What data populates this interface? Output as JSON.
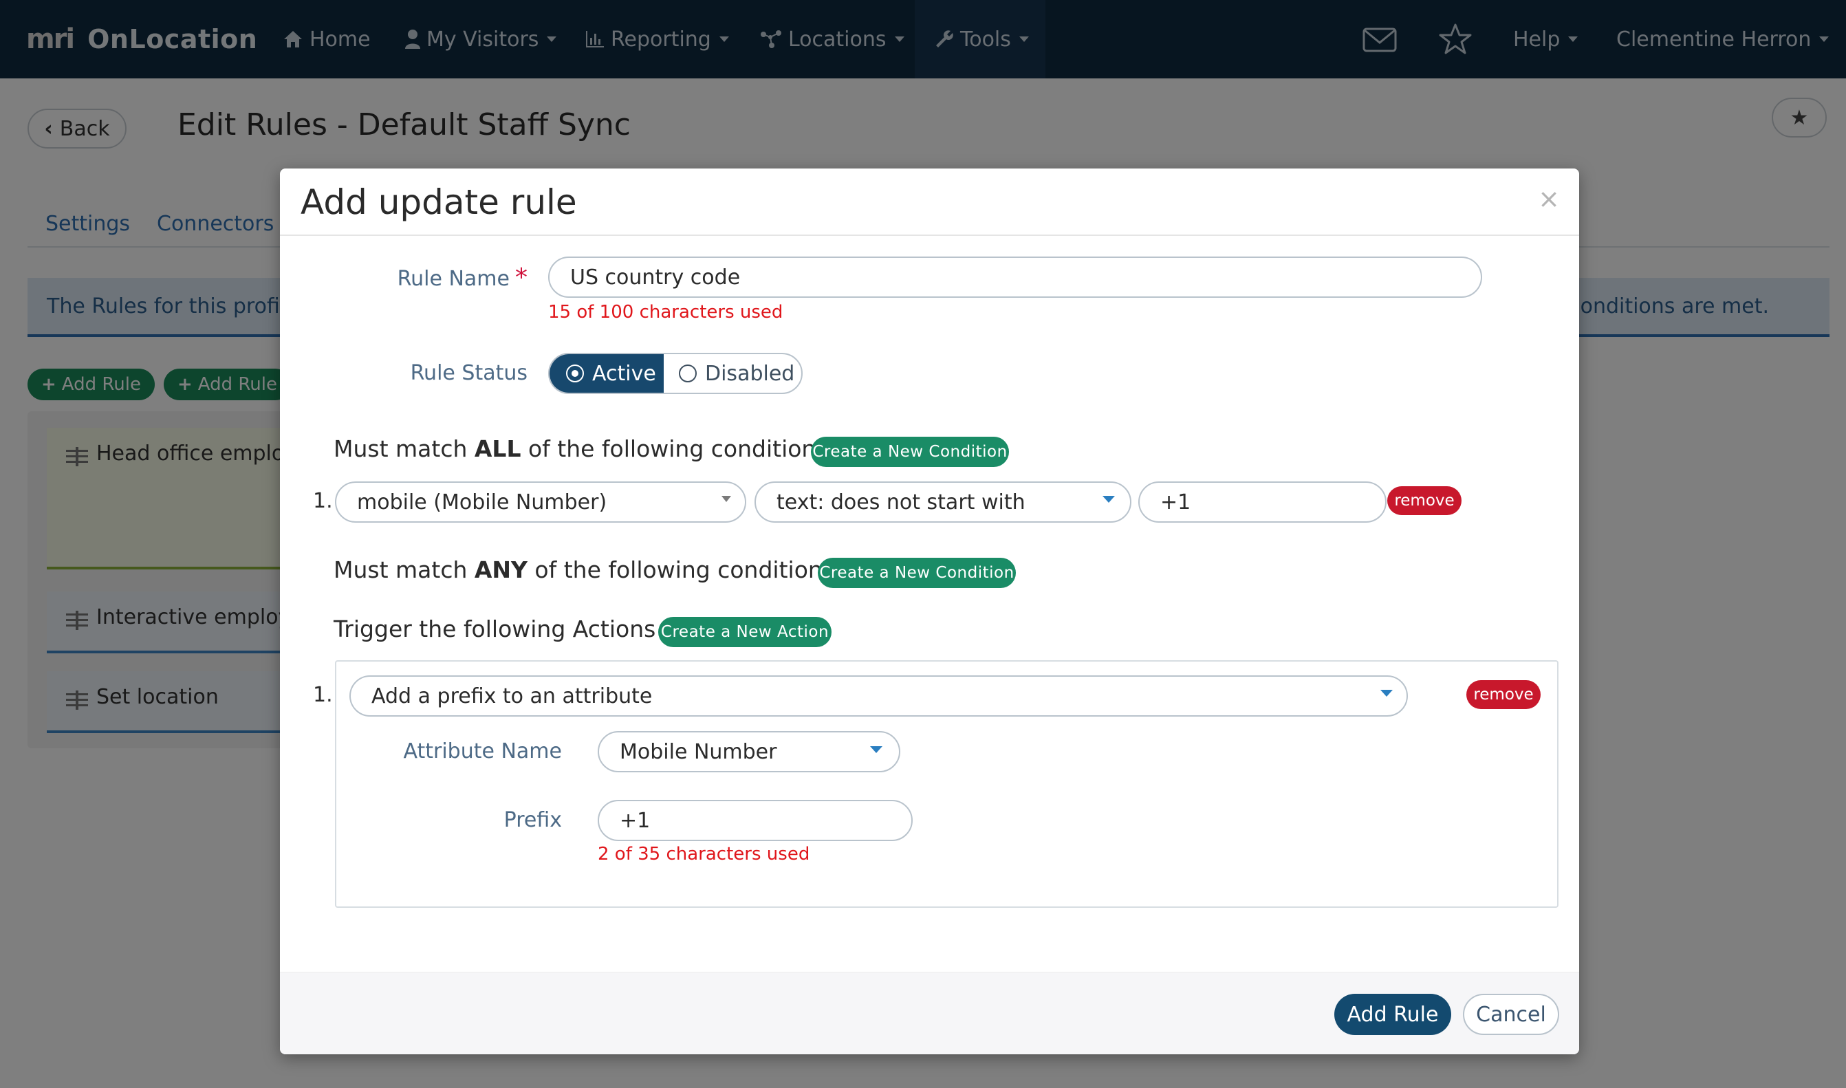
{
  "navbar": {
    "brand_logo": "mri",
    "brand_name": "OnLocation",
    "items": [
      {
        "label": "Home",
        "icon": "home-icon"
      },
      {
        "label": "My Visitors",
        "icon": "user-icon"
      },
      {
        "label": "Reporting",
        "icon": "bar-chart-icon"
      },
      {
        "label": "Locations",
        "icon": "network-icon"
      },
      {
        "label": "Tools",
        "icon": "wrench-icon"
      }
    ],
    "help_label": "Help",
    "user_name": "Clementine Herron",
    "mail_icon": "envelope-icon",
    "favorites_icon": "star-icon"
  },
  "page": {
    "back_label": "Back",
    "title": "Edit Rules - Default Staff Sync",
    "tabs": [
      "Settings",
      "Connectors"
    ],
    "info_left": "The Rules for this profile a",
    "info_right": "p conditions are met.",
    "add_rule_buttons": [
      "Add Rule",
      "Add Rule"
    ],
    "rules": [
      "Head office employe",
      "Interactive employee",
      "Set location"
    ]
  },
  "modal": {
    "title": "Add update rule",
    "close_label": "×",
    "rule_name_label": "Rule Name",
    "required_mark": "*",
    "rule_name_value": "US country code",
    "rule_name_hint": "15 of 100 characters used",
    "rule_status_label": "Rule Status",
    "status_active": "Active",
    "status_disabled": "Disabled",
    "status_selected": "Active",
    "all_conditions": {
      "prefix": "Must match ",
      "keyword": "ALL",
      "suffix": " of the following conditions",
      "create_label": "Create a New Condition",
      "rows": [
        {
          "index": "1.",
          "field": "mobile (Mobile Number)",
          "operator": "text: does not start with",
          "value": "+1",
          "remove_label": "remove"
        }
      ]
    },
    "any_conditions": {
      "prefix": "Must match ",
      "keyword": "ANY",
      "suffix": " of the following conditions",
      "create_label": "Create a New Condition"
    },
    "actions": {
      "title": "Trigger the following Actions",
      "create_label": "Create a New Action",
      "rows": [
        {
          "index": "1.",
          "action": "Add a prefix to an attribute",
          "remove_label": "remove",
          "attribute_label": "Attribute Name",
          "attribute_value": "Mobile Number",
          "prefix_label": "Prefix",
          "prefix_value": "+1",
          "prefix_hint": "2 of 35 characters used"
        }
      ]
    },
    "submit_label": "Add Rule",
    "cancel_label": "Cancel"
  },
  "colors": {
    "navbar": "#0e2a40",
    "primary": "#134a6f",
    "success": "#1a8c66",
    "danger": "#c8182c",
    "error_text": "#e0161b"
  }
}
